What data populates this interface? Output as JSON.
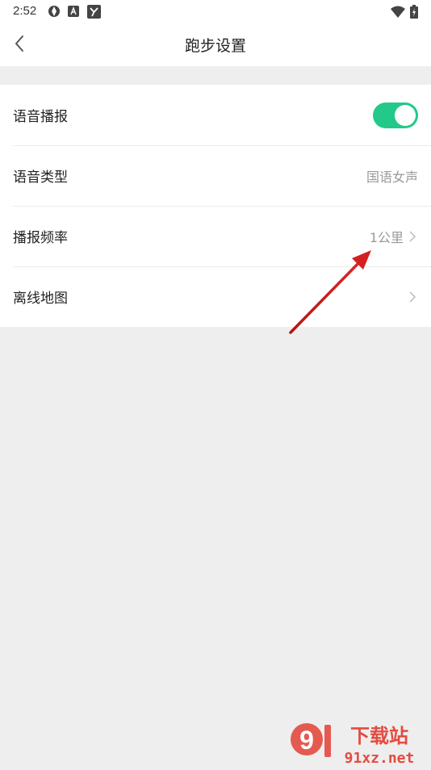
{
  "status_bar": {
    "time": "2:52",
    "icons": [
      "sync-icon",
      "app-a-icon",
      "app-y-icon",
      "wifi-icon",
      "battery-icon"
    ]
  },
  "header": {
    "back_icon": "chevron-left-icon",
    "title": "跑步设置"
  },
  "settings": {
    "items": [
      {
        "label": "语音播报",
        "control": "toggle",
        "enabled": true
      },
      {
        "label": "语音类型",
        "value": "国语女声"
      },
      {
        "label": "播报频率",
        "value": "1公里",
        "has_chevron": true
      },
      {
        "label": "离线地图",
        "has_chevron": true
      }
    ]
  },
  "colors": {
    "accent": "#23c98a",
    "background": "#eeeeee",
    "annotation": "#d42020"
  },
  "watermark": {
    "brand": "下载站",
    "domain": "91xz.net"
  }
}
